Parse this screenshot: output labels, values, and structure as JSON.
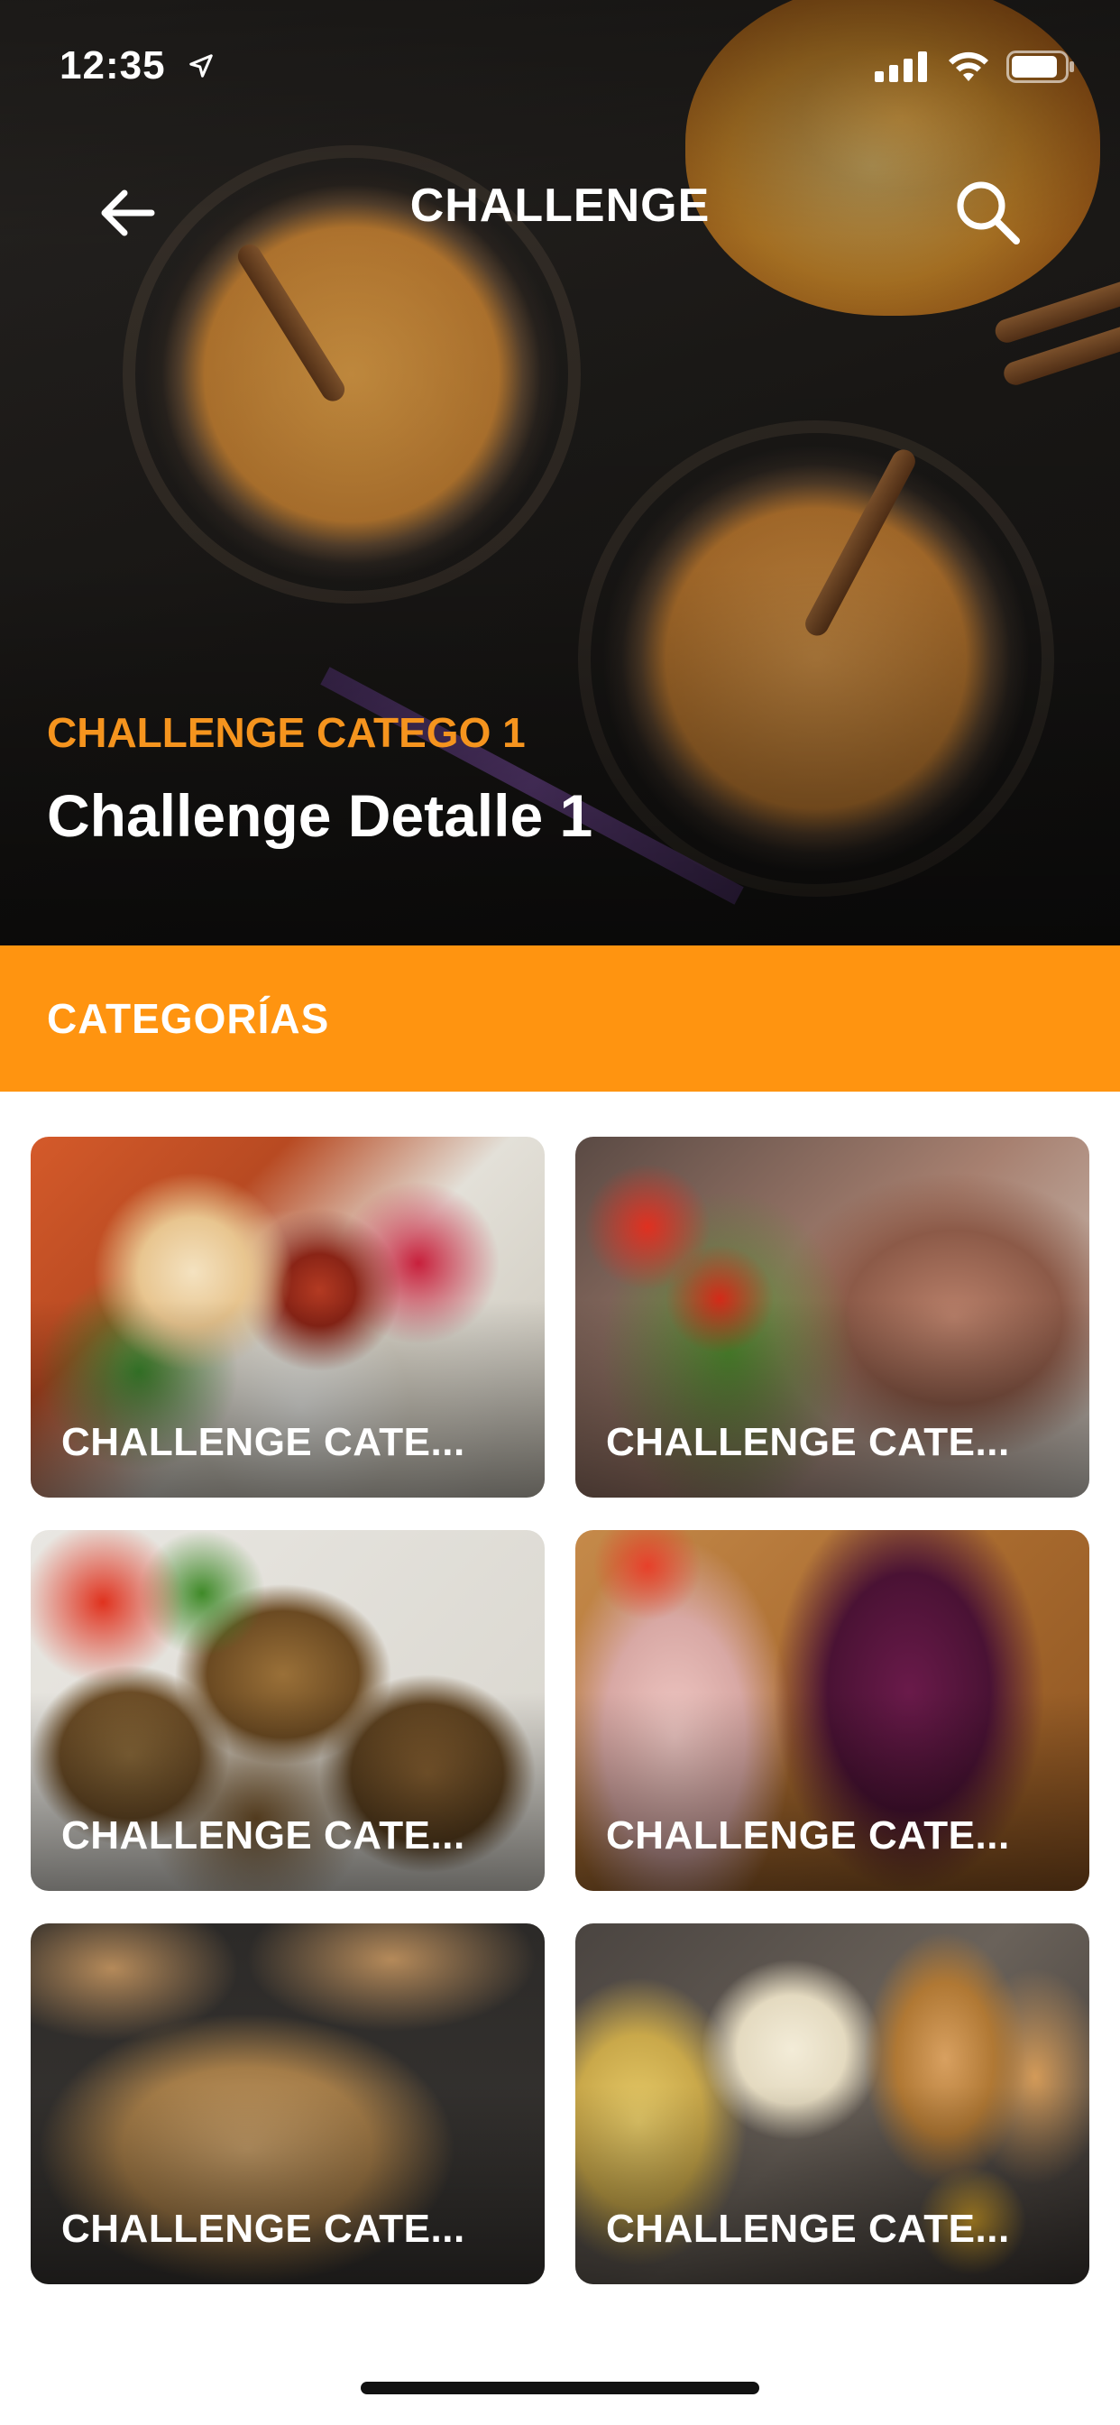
{
  "status_bar": {
    "time": "12:35"
  },
  "nav": {
    "title": "CHALLENGE"
  },
  "hero": {
    "category": "CHALLENGE CATEGO 1",
    "title": "Challenge Detalle 1"
  },
  "section": {
    "title": "CATEGORÍAS"
  },
  "categories": [
    {
      "label": "CHALLENGE CATE..."
    },
    {
      "label": "CHALLENGE CATE..."
    },
    {
      "label": "CHALLENGE CATE..."
    },
    {
      "label": "CHALLENGE CATE..."
    },
    {
      "label": "CHALLENGE CATE..."
    },
    {
      "label": "CHALLENGE CATE..."
    }
  ],
  "colors": {
    "accent": "#ff9410",
    "hero_category": "#f5941e"
  }
}
